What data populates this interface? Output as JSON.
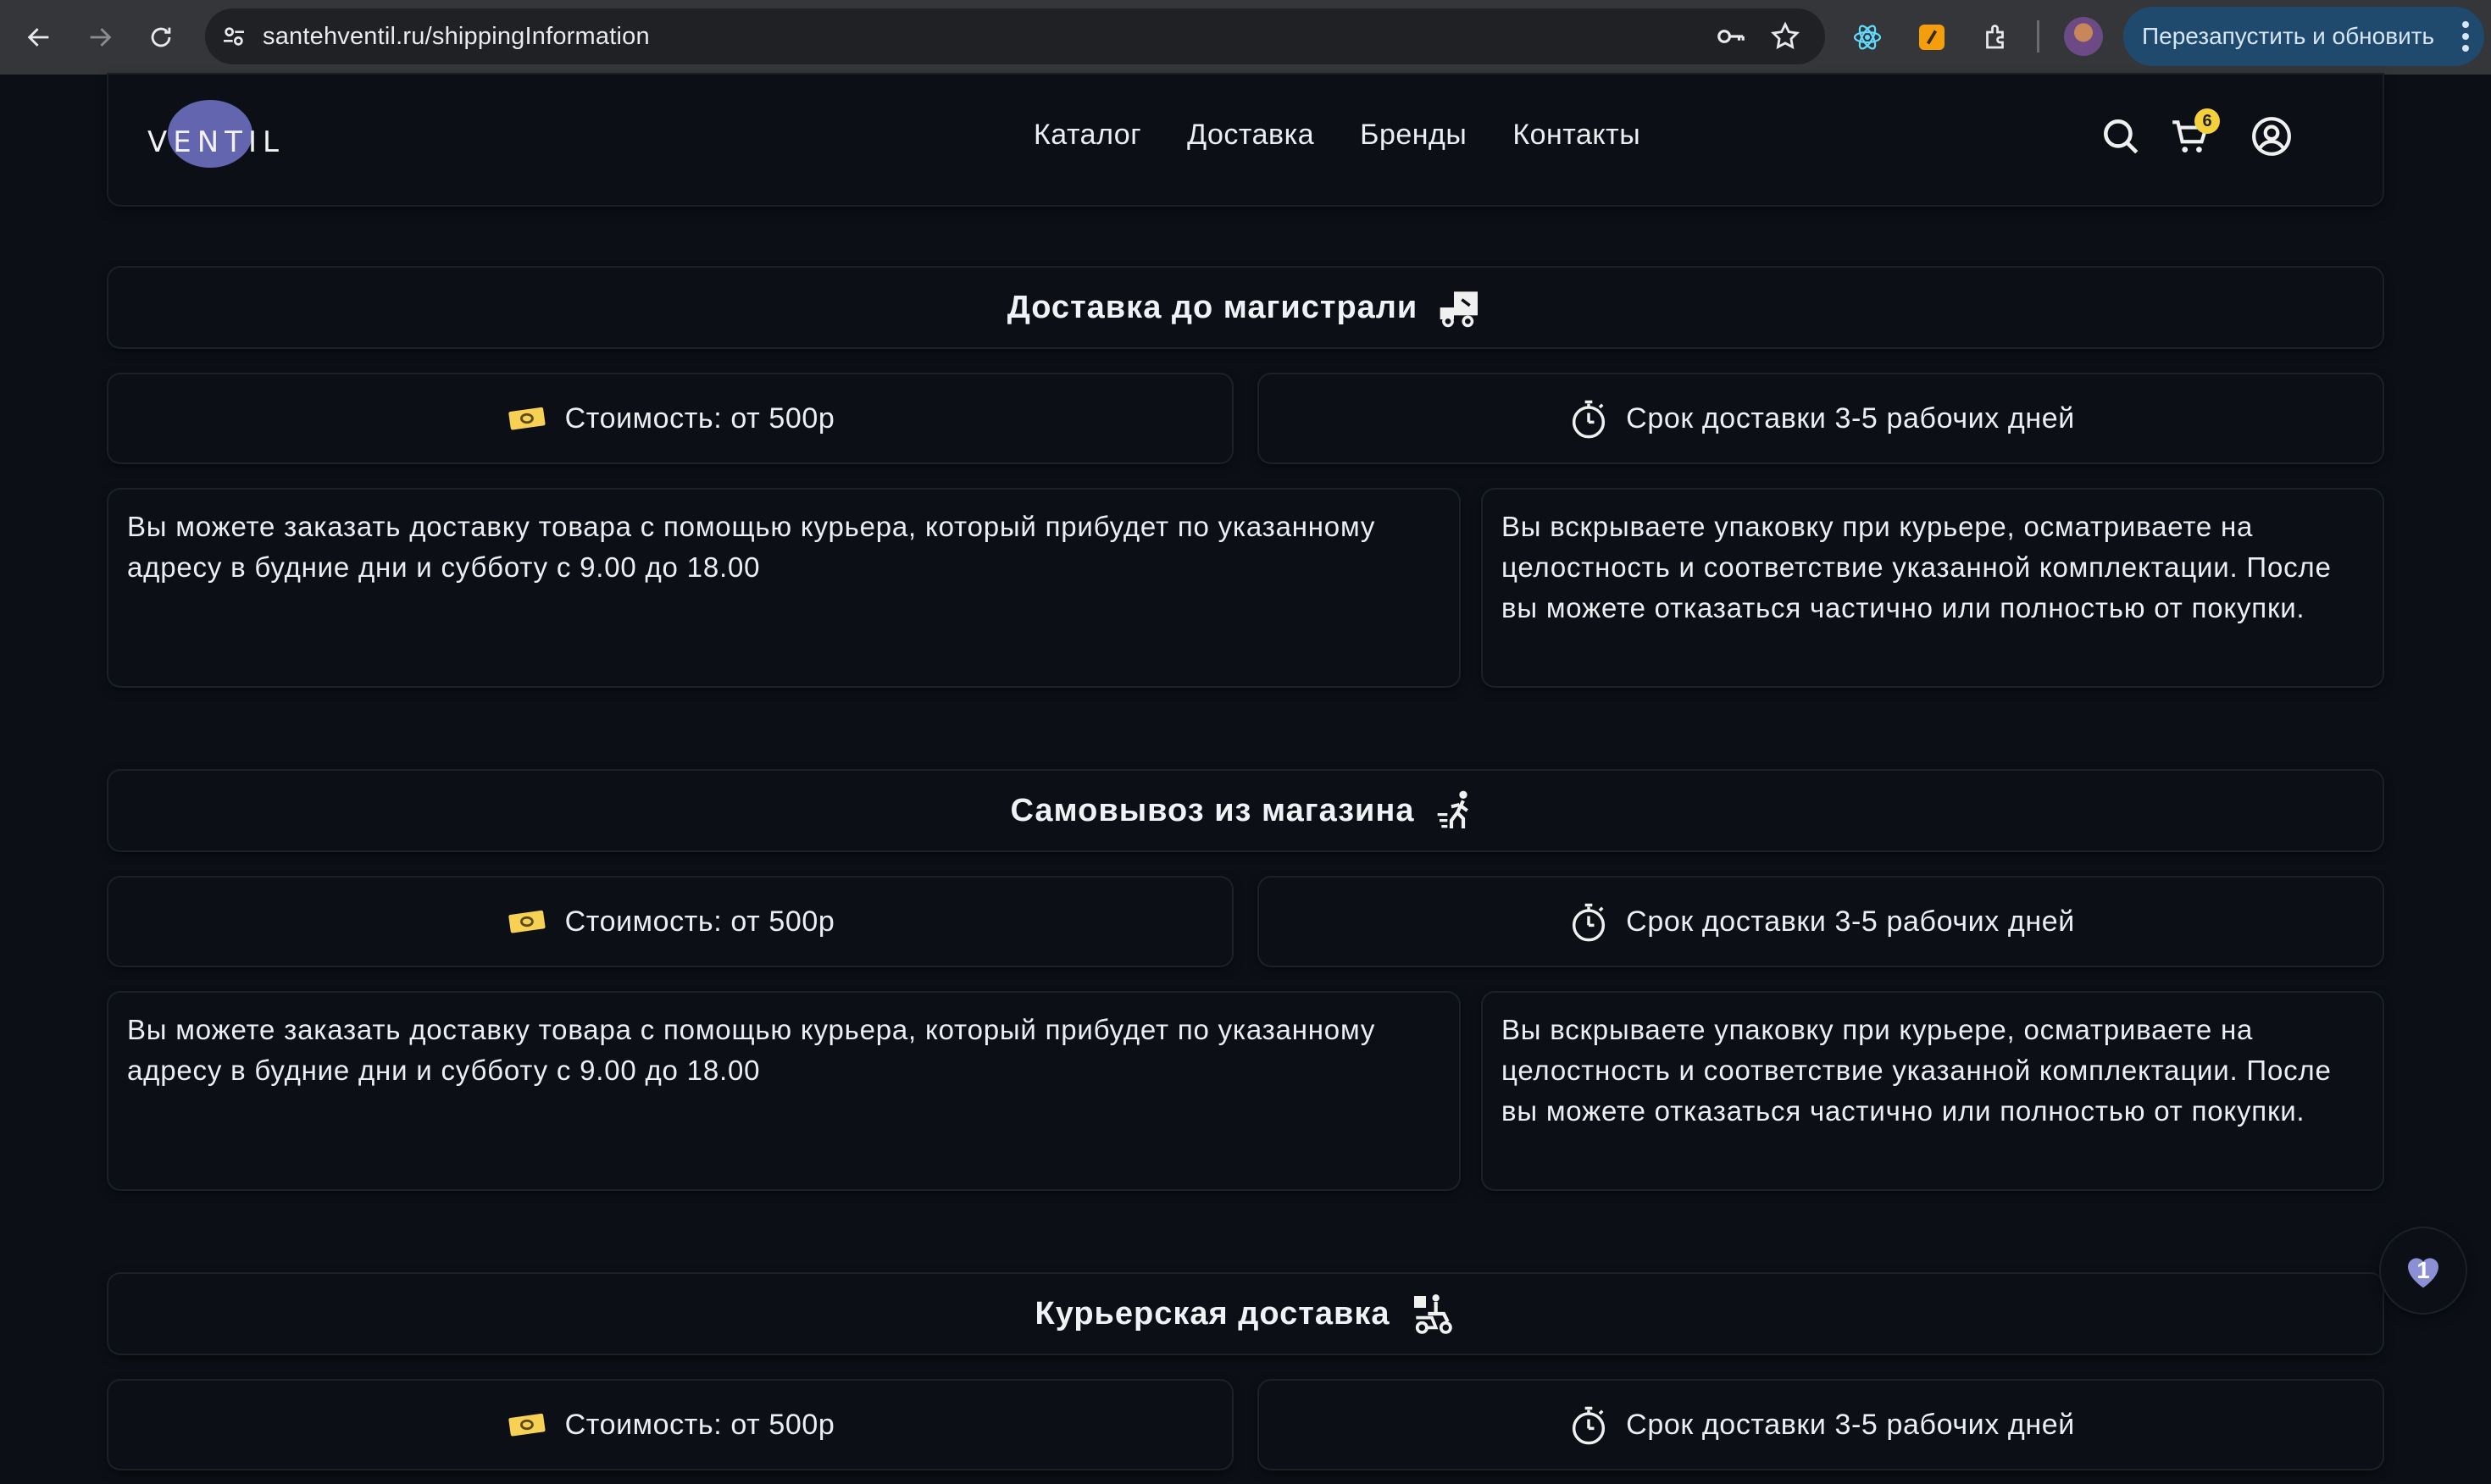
{
  "browser": {
    "url": "santehventil.ru/shippingInformation",
    "update_label": "Перезапустить и обновить"
  },
  "header": {
    "logo_text": "VENTIL",
    "nav": [
      "Каталог",
      "Доставка",
      "Бренды",
      "Контакты"
    ],
    "cart_count": "6"
  },
  "sections": [
    {
      "title": "Доставка до магистрали",
      "icon": "truck-box-icon",
      "cost": "Стоимость: от 500р",
      "term": "Срок доставки 3-5 рабочих дней",
      "desc_left": "Вы можете заказать доставку товара с помощью курьера, который прибудет по указанному адресу в будние дни и субботу с 9.00 до 18.00",
      "desc_right": "Вы вскрываете упаковку при курьере, осматриваете на целостность и соответствие указанной комплектации. После вы можете отказаться частично или полностью от покупки."
    },
    {
      "title": "Самовывоз из магазина",
      "icon": "walking-person-icon",
      "cost": "Стоимость: от 500р",
      "term": "Срок доставки 3-5 рабочих дней",
      "desc_left": "Вы можете заказать доставку товара с помощью курьера, который прибудет по указанному адресу в будние дни и субботу с 9.00 до 18.00",
      "desc_right": "Вы вскрываете упаковку при курьере, осматриваете на целостность и соответствие указанной комплектации. После вы можете отказаться частично или полностью от покупки."
    },
    {
      "title": "Курьерская доставка",
      "icon": "courier-scooter-icon",
      "cost": "Стоимость: от 500р",
      "term": "Срок доставки 3-5 рабочих дней"
    }
  ],
  "floating": {
    "like_count": "1"
  },
  "colors": {
    "page_bg": "#0c1016",
    "browser_bar": "#35363a",
    "update_button": "#1f4a6e",
    "cart_badge": "#f4d03f",
    "accent_purple": "#6e6fc0"
  }
}
